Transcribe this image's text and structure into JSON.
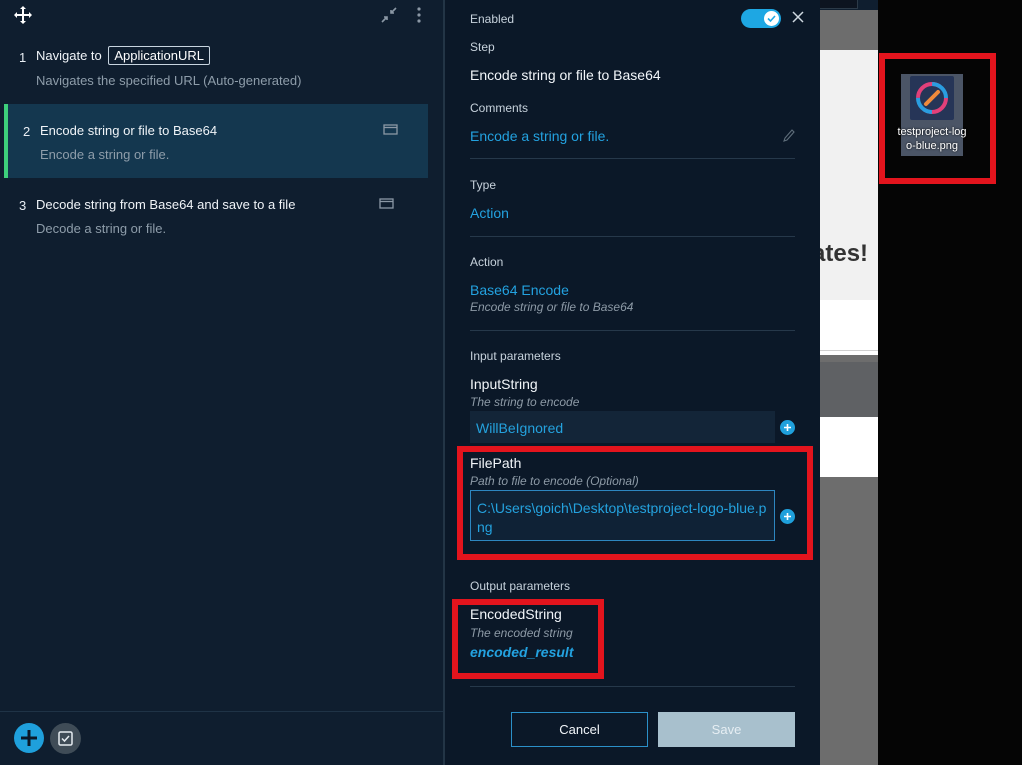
{
  "steps": [
    {
      "num": "1",
      "title_prefix": "Navigate to",
      "param": "ApplicationURL",
      "subtitle": "Navigates the specified URL (Auto-generated)"
    },
    {
      "num": "2",
      "title": "Encode string or file to Base64",
      "subtitle": "Encode a string or file."
    },
    {
      "num": "3",
      "title": "Decode string from Base64 and save to a file",
      "subtitle": "Decode a string or file."
    }
  ],
  "editor": {
    "enabled_label": "Enabled",
    "step_label": "Step",
    "step_value": "Encode string or file to Base64",
    "comments_label": "Comments",
    "comments_value": "Encode a string or file.",
    "type_label": "Type",
    "type_value": "Action",
    "action_label": "Action",
    "action_value": "Base64 Encode",
    "action_hint": "Encode string or file to Base64",
    "input_params_label": "Input parameters",
    "inputs": [
      {
        "name": "InputString",
        "hint": "The string to encode",
        "value": "WillBeIgnored"
      },
      {
        "name": "FilePath",
        "hint": "Path to file to encode (Optional)",
        "value": "C:\\Users\\goich\\Desktop\\testproject-logo-blue.png"
      }
    ],
    "output_params_label": "Output parameters",
    "output": {
      "name": "EncodedString",
      "hint": "The encoded string",
      "value": "encoded_result"
    },
    "cancel_label": "Cancel",
    "save_label": "Save"
  },
  "background": {
    "page_heading_fragment": "ates!"
  },
  "desktop": {
    "file_icon_label": "testproject-logo-blue.png"
  },
  "colors": {
    "accent": "#1fa0dc",
    "selected_step_bar": "#3ed07c",
    "annotation_red": "#e3141d"
  },
  "icons": [
    "move-icon",
    "collapse-icon",
    "kebab-icon",
    "step-card-icon",
    "add-icon",
    "check-icon",
    "close-icon",
    "pencil-icon",
    "plus-icon"
  ]
}
